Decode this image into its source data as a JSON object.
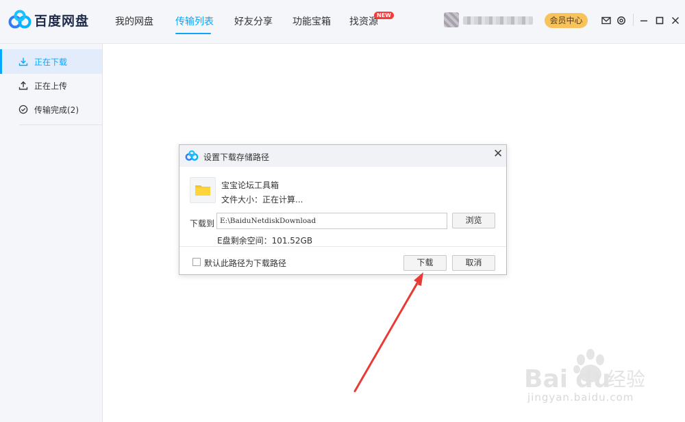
{
  "app": {
    "brand": "百度网盘",
    "colors": {
      "accent": "#06a7ff",
      "vip": "#f7c35a",
      "arrow": "#ea3a36"
    }
  },
  "nav": {
    "items": [
      {
        "label": "我的网盘"
      },
      {
        "label": "传输列表",
        "active": true
      },
      {
        "label": "好友分享"
      },
      {
        "label": "功能宝箱"
      },
      {
        "label": "找资源",
        "badge": "NEW"
      }
    ]
  },
  "user": {
    "vip_label": "会员中心",
    "icons": [
      "mail-icon",
      "settings-icon",
      "minimize-icon",
      "maximize-icon",
      "close-icon"
    ]
  },
  "sidebar": {
    "items": [
      {
        "label": "正在下载",
        "icon": "download-icon",
        "active": true
      },
      {
        "label": "正在上传",
        "icon": "upload-icon"
      },
      {
        "label": "传输完成(2)",
        "icon": "check-circle-icon"
      }
    ]
  },
  "dialog": {
    "title": "设置下载存储路径",
    "file_name": "宝宝论坛工具箱",
    "file_size": "文件大小：正在计算...",
    "path_label": "下载到",
    "path_value": "E:\\BaiduNetdiskDownload",
    "browse_label": "浏览",
    "disk_space": "E盘剩余空间：101.52GB",
    "default_path_label": "默认此路径为下载路径",
    "download_label": "下载",
    "cancel_label": "取消"
  },
  "watermark": {
    "text": "jingyan.baidu.com",
    "logo_text": "Baidu经验"
  }
}
